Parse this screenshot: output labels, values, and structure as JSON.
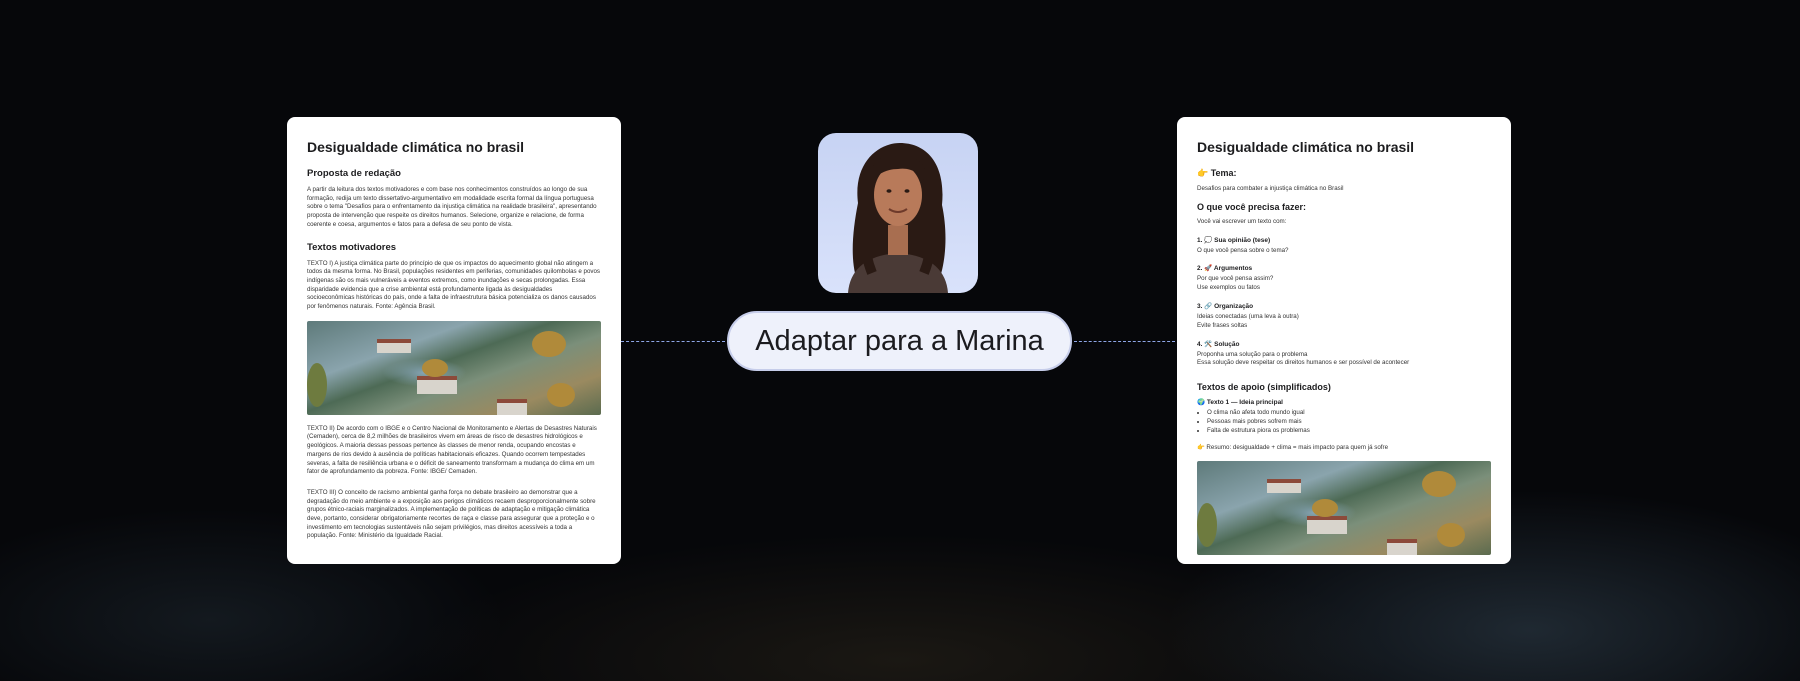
{
  "left_doc": {
    "title": "Desigualdade climática no brasil",
    "proposta_heading": "Proposta de redação",
    "proposta_text": "A partir da leitura dos textos motivadores e com base nos conhecimentos construídos ao longo de sua formação, redija um texto dissertativo-argumentativo em modalidade escrita formal da língua portuguesa sobre o tema \"Desafios para o enfrentamento da injustiça climática na realidade brasileira\", apresentando proposta de intervenção que respeite os direitos humanos. Selecione, organize e relacione, de forma coerente e coesa, argumentos e fatos para a defesa de seu ponto de vista.",
    "textos_heading": "Textos motivadores",
    "texto1": "TEXTO I) A justiça climática parte do princípio de que os impactos do aquecimento global não atingem a todos da mesma forma. No Brasil, populações residentes em periferias, comunidades quilombolas e povos indígenas são os mais vulneráveis a eventos extremos, como inundações e secas prolongadas. Essa disparidade evidencia que a crise ambiental está profundamente ligada às desigualdades socioeconômicas históricas do país, onde a falta de infraestrutura básica potencializa os danos causados por fenômenos naturais. Fonte: Agência Brasil.",
    "texto2": "TEXTO II) De acordo com o IBGE e o Centro Nacional de Monitoramento e Alertas de Desastres Naturais (Cemaden), cerca de 8,2 milhões de brasileiros vivem em áreas de risco de desastres hidrológicos e geológicos. A maioria dessas pessoas pertence às classes de menor renda, ocupando encostas e margens de rios devido à ausência de políticas habitacionais eficazes. Quando ocorrem tempestades severas, a falta de resiliência urbana e o déficit de saneamento transformam a mudança do clima em um fator de aprofundamento da pobreza. Fonte: IBGE/ Cemaden.",
    "texto3": "TEXTO III) O conceito de racismo ambiental ganha força no debate brasileiro ao demonstrar que a degradação do meio ambiente e a exposição aos perigos climáticos recaem desproporcionalmente sobre grupos étnico-raciais marginalizados. A implementação de políticas de adaptação e mitigação climática deve, portanto, considerar obrigatoriamente recortes de raça e classe para assegurar que a proteção e o investimento em tecnologias sustentáveis não sejam privilégios, mas direitos acessíveis a toda a população. Fonte: Ministério da Igualdade Racial."
  },
  "center": {
    "action_label": "Adaptar para a Marina"
  },
  "right_doc": {
    "title": "Desigualdade climática no brasil",
    "tema_label": "👉 Tema:",
    "tema_text": "Desafios para combater a injustiça climática no Brasil",
    "fazer_heading": "O que você precisa fazer:",
    "fazer_intro": "Você vai escrever um texto com:",
    "steps": [
      {
        "title": "1. 💭 Sua opinião (tese)",
        "lines": [
          "O que você pensa sobre o tema?"
        ]
      },
      {
        "title": "2. 🚀 Argumentos",
        "lines": [
          "Por que você pensa assim?",
          "Use exemplos ou fatos"
        ]
      },
      {
        "title": "3. 🔗 Organização",
        "lines": [
          "Ideias conectadas (uma leva à outra)",
          "Evite frases soltas"
        ]
      },
      {
        "title": "4. 🛠️ Solução",
        "lines": [
          "Proponha uma solução para o problema",
          "Essa solução deve respeitar os direitos humanos e ser possível de acontecer"
        ]
      }
    ],
    "apoio_heading": "Textos de apoio (simplificados)",
    "texto1_title": "🌍 Texto 1 — Ideia principal",
    "texto1_bullets": [
      "O clima não afeta todo mundo igual",
      "Pessoas mais pobres sofrem mais",
      "Falta de estrutura piora os problemas"
    ],
    "resumo": "👉 Resumo: desigualdade + clima = mais impacto para quem já sofre"
  }
}
